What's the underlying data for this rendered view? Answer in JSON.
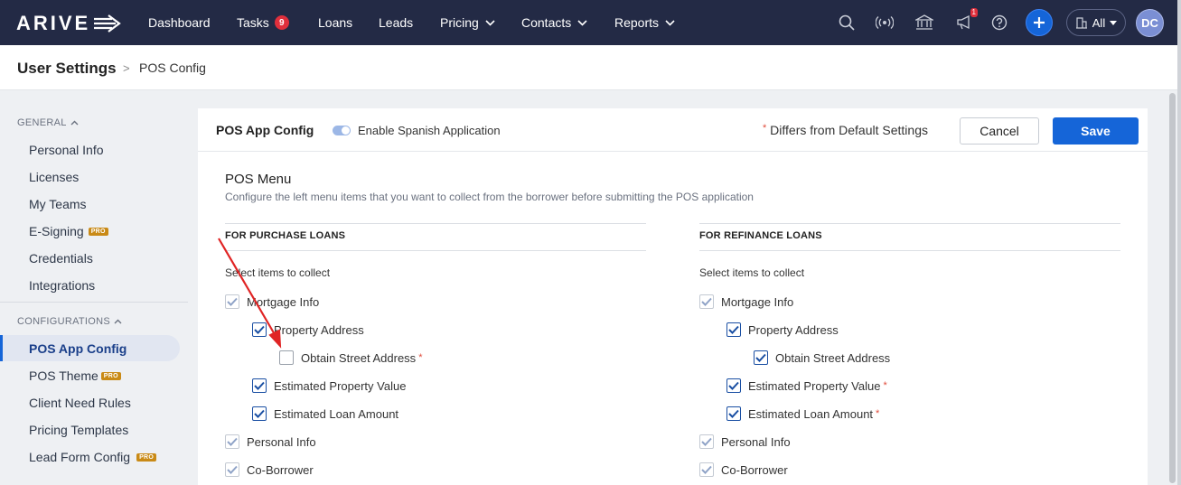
{
  "brand": {
    "logo_text": "ARIVE"
  },
  "nav": {
    "items": [
      {
        "label": "Dashboard"
      },
      {
        "label": "Tasks",
        "badge": "9"
      },
      {
        "label": "Loans"
      },
      {
        "label": "Leads"
      },
      {
        "label": "Pricing"
      },
      {
        "label": "Contacts"
      },
      {
        "label": "Reports"
      }
    ],
    "notification_count": "1",
    "scope_label": "All",
    "avatar_initials": "DC"
  },
  "breadcrumb": {
    "title": "User Settings",
    "separator": ">",
    "current": "POS Config"
  },
  "sidebar": {
    "general_heading": "GENERAL",
    "general_items": [
      {
        "label": "Personal Info"
      },
      {
        "label": "Licenses"
      },
      {
        "label": "My Teams"
      },
      {
        "label": "E-Signing",
        "badge": "PRO"
      },
      {
        "label": "Credentials"
      },
      {
        "label": "Integrations"
      }
    ],
    "config_heading": "CONFIGURATIONS",
    "config_items": [
      {
        "label": "POS App Config",
        "active": true
      },
      {
        "label": "POS Theme",
        "badge": "PRO"
      },
      {
        "label": "Client Need Rules"
      },
      {
        "label": "Pricing Templates"
      },
      {
        "label": "Lead Form Config",
        "badge": "PRO"
      }
    ]
  },
  "panel": {
    "title": "POS App Config",
    "toggle_label": "Enable Spanish Application",
    "differs_note": "Differs from Default Settings",
    "required_marker": "*",
    "cancel_label": "Cancel",
    "save_label": "Save",
    "section_title": "POS Menu",
    "section_desc": "Configure the left menu items that you want to collect from the borrower before submitting the POS application"
  },
  "purchase": {
    "heading": "FOR PURCHASE LOANS",
    "subheading": "Select items to collect",
    "items": [
      {
        "label": "Mortgage Info",
        "state": "dim"
      },
      {
        "label": "Property Address",
        "state": "on"
      },
      {
        "label": "Obtain Street Address",
        "state": "off",
        "differs": true
      },
      {
        "label": "Estimated Property Value",
        "state": "on"
      },
      {
        "label": "Estimated Loan Amount",
        "state": "on"
      },
      {
        "label": "Personal Info",
        "state": "dim"
      },
      {
        "label": "Co-Borrower",
        "state": "dim"
      }
    ]
  },
  "refinance": {
    "heading": "FOR REFINANCE LOANS",
    "subheading": "Select items to collect",
    "items": [
      {
        "label": "Mortgage Info",
        "state": "dim"
      },
      {
        "label": "Property Address",
        "state": "on"
      },
      {
        "label": "Obtain Street Address",
        "state": "on"
      },
      {
        "label": "Estimated Property Value",
        "state": "on",
        "differs": true
      },
      {
        "label": "Estimated Loan Amount",
        "state": "on",
        "differs": true
      },
      {
        "label": "Personal Info",
        "state": "dim"
      },
      {
        "label": "Co-Borrower",
        "state": "dim"
      }
    ]
  },
  "colors": {
    "nav_bg": "#232a45",
    "accent": "#1565d8",
    "annotation": "#e02424"
  }
}
